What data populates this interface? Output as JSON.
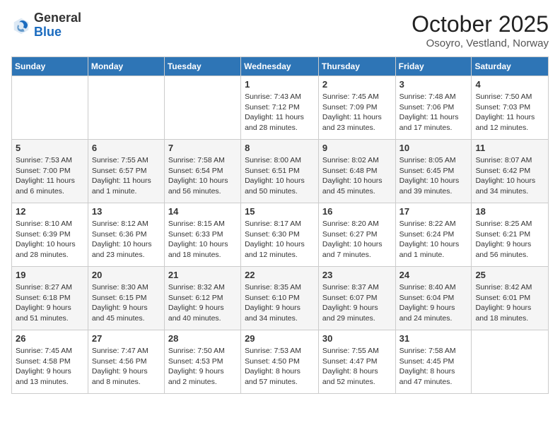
{
  "header": {
    "logo_general": "General",
    "logo_blue": "Blue",
    "month": "October 2025",
    "location": "Osoyro, Vestland, Norway"
  },
  "days_of_week": [
    "Sunday",
    "Monday",
    "Tuesday",
    "Wednesday",
    "Thursday",
    "Friday",
    "Saturday"
  ],
  "weeks": [
    [
      {
        "day": "",
        "info": ""
      },
      {
        "day": "",
        "info": ""
      },
      {
        "day": "",
        "info": ""
      },
      {
        "day": "1",
        "info": "Sunrise: 7:43 AM\nSunset: 7:12 PM\nDaylight: 11 hours and 28 minutes."
      },
      {
        "day": "2",
        "info": "Sunrise: 7:45 AM\nSunset: 7:09 PM\nDaylight: 11 hours and 23 minutes."
      },
      {
        "day": "3",
        "info": "Sunrise: 7:48 AM\nSunset: 7:06 PM\nDaylight: 11 hours and 17 minutes."
      },
      {
        "day": "4",
        "info": "Sunrise: 7:50 AM\nSunset: 7:03 PM\nDaylight: 11 hours and 12 minutes."
      }
    ],
    [
      {
        "day": "5",
        "info": "Sunrise: 7:53 AM\nSunset: 7:00 PM\nDaylight: 11 hours and 6 minutes."
      },
      {
        "day": "6",
        "info": "Sunrise: 7:55 AM\nSunset: 6:57 PM\nDaylight: 11 hours and 1 minute."
      },
      {
        "day": "7",
        "info": "Sunrise: 7:58 AM\nSunset: 6:54 PM\nDaylight: 10 hours and 56 minutes."
      },
      {
        "day": "8",
        "info": "Sunrise: 8:00 AM\nSunset: 6:51 PM\nDaylight: 10 hours and 50 minutes."
      },
      {
        "day": "9",
        "info": "Sunrise: 8:02 AM\nSunset: 6:48 PM\nDaylight: 10 hours and 45 minutes."
      },
      {
        "day": "10",
        "info": "Sunrise: 8:05 AM\nSunset: 6:45 PM\nDaylight: 10 hours and 39 minutes."
      },
      {
        "day": "11",
        "info": "Sunrise: 8:07 AM\nSunset: 6:42 PM\nDaylight: 10 hours and 34 minutes."
      }
    ],
    [
      {
        "day": "12",
        "info": "Sunrise: 8:10 AM\nSunset: 6:39 PM\nDaylight: 10 hours and 28 minutes."
      },
      {
        "day": "13",
        "info": "Sunrise: 8:12 AM\nSunset: 6:36 PM\nDaylight: 10 hours and 23 minutes."
      },
      {
        "day": "14",
        "info": "Sunrise: 8:15 AM\nSunset: 6:33 PM\nDaylight: 10 hours and 18 minutes."
      },
      {
        "day": "15",
        "info": "Sunrise: 8:17 AM\nSunset: 6:30 PM\nDaylight: 10 hours and 12 minutes."
      },
      {
        "day": "16",
        "info": "Sunrise: 8:20 AM\nSunset: 6:27 PM\nDaylight: 10 hours and 7 minutes."
      },
      {
        "day": "17",
        "info": "Sunrise: 8:22 AM\nSunset: 6:24 PM\nDaylight: 10 hours and 1 minute."
      },
      {
        "day": "18",
        "info": "Sunrise: 8:25 AM\nSunset: 6:21 PM\nDaylight: 9 hours and 56 minutes."
      }
    ],
    [
      {
        "day": "19",
        "info": "Sunrise: 8:27 AM\nSunset: 6:18 PM\nDaylight: 9 hours and 51 minutes."
      },
      {
        "day": "20",
        "info": "Sunrise: 8:30 AM\nSunset: 6:15 PM\nDaylight: 9 hours and 45 minutes."
      },
      {
        "day": "21",
        "info": "Sunrise: 8:32 AM\nSunset: 6:12 PM\nDaylight: 9 hours and 40 minutes."
      },
      {
        "day": "22",
        "info": "Sunrise: 8:35 AM\nSunset: 6:10 PM\nDaylight: 9 hours and 34 minutes."
      },
      {
        "day": "23",
        "info": "Sunrise: 8:37 AM\nSunset: 6:07 PM\nDaylight: 9 hours and 29 minutes."
      },
      {
        "day": "24",
        "info": "Sunrise: 8:40 AM\nSunset: 6:04 PM\nDaylight: 9 hours and 24 minutes."
      },
      {
        "day": "25",
        "info": "Sunrise: 8:42 AM\nSunset: 6:01 PM\nDaylight: 9 hours and 18 minutes."
      }
    ],
    [
      {
        "day": "26",
        "info": "Sunrise: 7:45 AM\nSunset: 4:58 PM\nDaylight: 9 hours and 13 minutes."
      },
      {
        "day": "27",
        "info": "Sunrise: 7:47 AM\nSunset: 4:56 PM\nDaylight: 9 hours and 8 minutes."
      },
      {
        "day": "28",
        "info": "Sunrise: 7:50 AM\nSunset: 4:53 PM\nDaylight: 9 hours and 2 minutes."
      },
      {
        "day": "29",
        "info": "Sunrise: 7:53 AM\nSunset: 4:50 PM\nDaylight: 8 hours and 57 minutes."
      },
      {
        "day": "30",
        "info": "Sunrise: 7:55 AM\nSunset: 4:47 PM\nDaylight: 8 hours and 52 minutes."
      },
      {
        "day": "31",
        "info": "Sunrise: 7:58 AM\nSunset: 4:45 PM\nDaylight: 8 hours and 47 minutes."
      },
      {
        "day": "",
        "info": ""
      }
    ]
  ]
}
